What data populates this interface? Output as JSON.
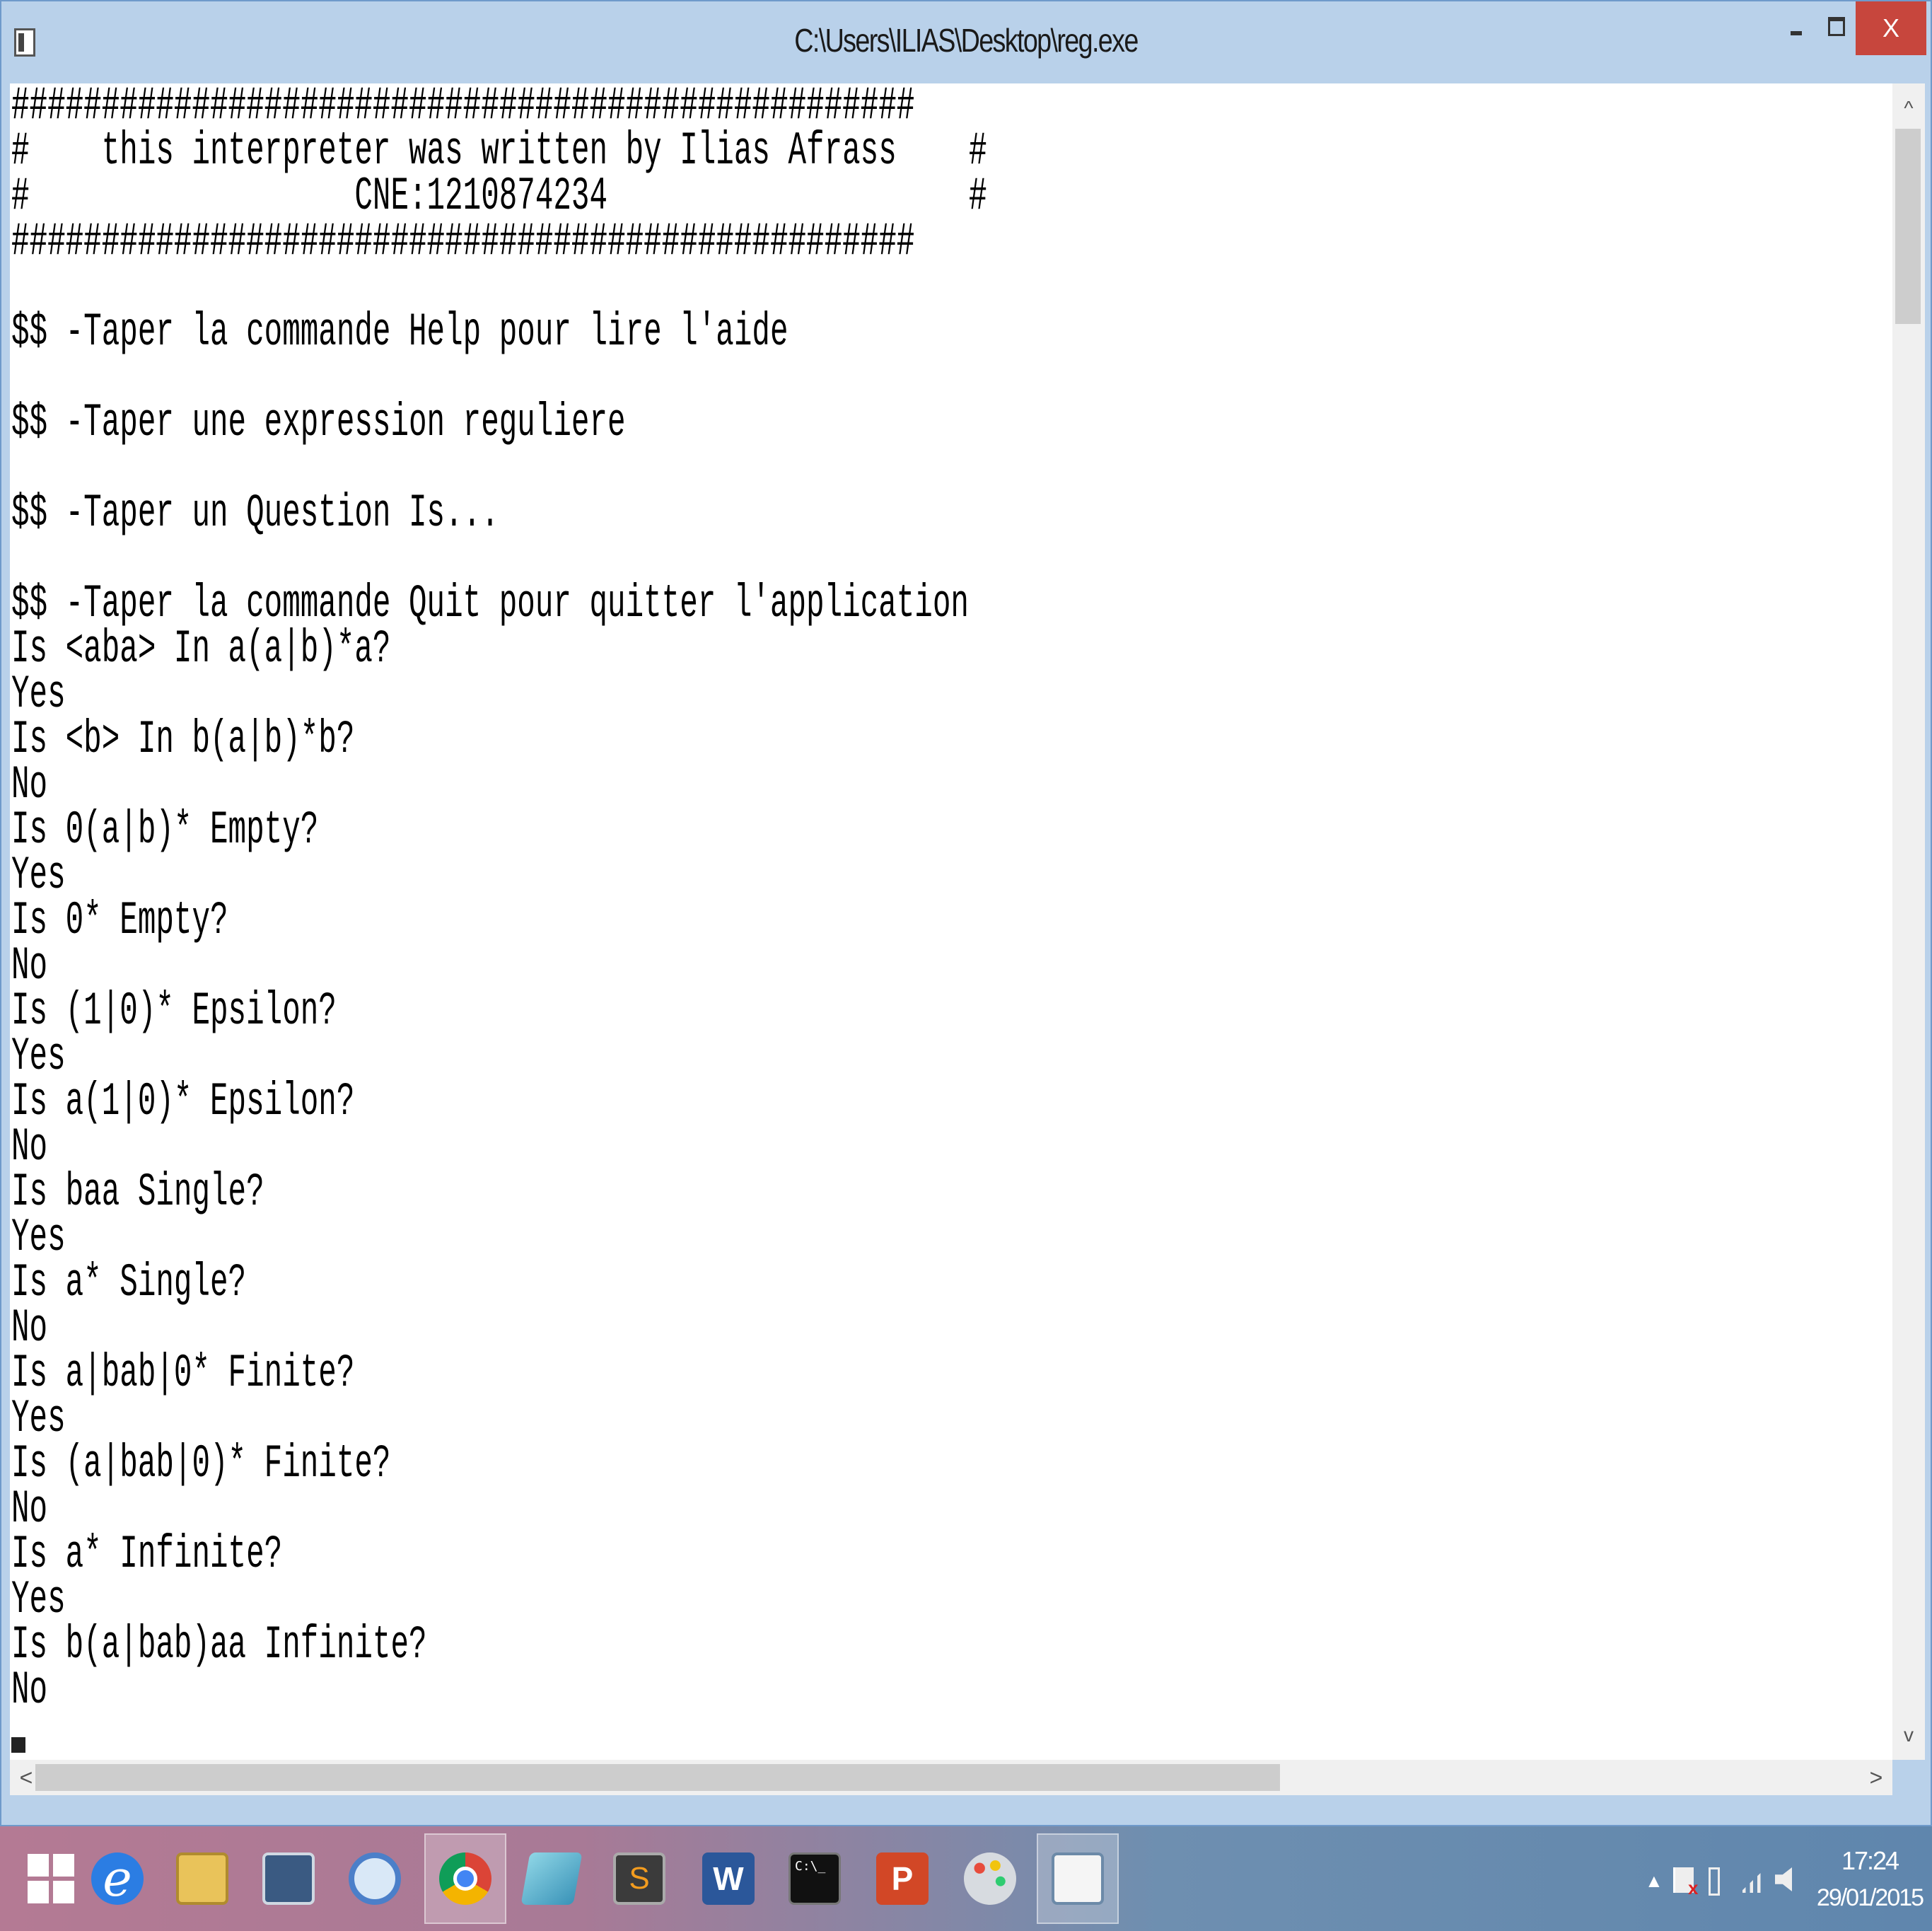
{
  "window": {
    "title": "C:\\Users\\ILIAS\\Desktop\\reg.exe",
    "close_label": "X"
  },
  "console": {
    "lines": [
      "##################################################",
      "#    this interpreter was written by Ilias Afrass    #",
      "#                  CNE:1210874234                    #",
      "##################################################",
      "",
      "$$ -Taper la commande Help pour lire l'aide",
      "",
      "$$ -Taper une expression reguliere",
      "",
      "$$ -Taper un Question Is...",
      "",
      "$$ -Taper la commande Quit pour quitter l'application",
      "Is <aba> In a(a|b)*a?",
      "Yes",
      "Is <b> In b(a|b)*b?",
      "No",
      "Is 0(a|b)* Empty?",
      "Yes",
      "Is 0* Empty?",
      "No",
      "Is (1|0)* Epsilon?",
      "Yes",
      "Is a(1|0)* Epsilon?",
      "No",
      "Is baa Single?",
      "Yes",
      "Is a* Single?",
      "No",
      "Is a|bab|0* Finite?",
      "Yes",
      "Is (a|bab|0)* Finite?",
      "No",
      "Is a* Infinite?",
      "Yes",
      "Is b(a|bab)aa Infinite?",
      "No"
    ]
  },
  "scrollbars": {
    "up": "^",
    "down": "v",
    "left": "<",
    "right": ">"
  },
  "taskbar": {
    "apps": [
      {
        "name": "start",
        "icon": "windows-logo-icon"
      },
      {
        "name": "internet-explorer",
        "icon": "ie-icon",
        "glyph": "e"
      },
      {
        "name": "file-explorer",
        "icon": "folder-icon"
      },
      {
        "name": "computer",
        "icon": "computer-icon"
      },
      {
        "name": "skype",
        "icon": "skype-icon"
      },
      {
        "name": "chrome",
        "icon": "chrome-icon"
      },
      {
        "name": "notes",
        "icon": "notes-icon"
      },
      {
        "name": "sublime-text",
        "icon": "sublime-icon",
        "glyph": "S"
      },
      {
        "name": "word",
        "icon": "word-icon",
        "glyph": "W"
      },
      {
        "name": "command-prompt",
        "icon": "cmd-icon",
        "glyph": "C:\\_"
      },
      {
        "name": "powerpoint",
        "icon": "powerpoint-icon",
        "glyph": "P"
      },
      {
        "name": "paint",
        "icon": "paint-icon"
      },
      {
        "name": "reg-exe",
        "icon": "console-window-icon"
      }
    ],
    "clock": {
      "time": "17:24",
      "date": "29/01/2015"
    },
    "tray_arrow": "▲"
  },
  "colors": {
    "title_bar": "#b9d1ea",
    "close_button": "#c7463d",
    "console_bg": "#ffffff",
    "console_text": "#000000"
  }
}
